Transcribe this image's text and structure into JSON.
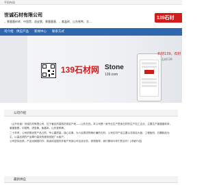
{
  "topbar": {
    "text": "平机布局"
  },
  "header": {
    "company_name": "世诚石材有限公司",
    "keywords": "，景墨墨砂砖、中国黑、虎皮黄、景墨墨基、，紫晶砖、山东铁鸭、文…",
    "logo_text": "139石材"
  },
  "nav": {
    "items": [
      {
        "label": "司介绍"
      },
      {
        "label": "供应产品"
      },
      {
        "label": "新闻中心"
      },
      {
        "label": "联系方式"
      }
    ]
  },
  "banner": {
    "brand_139": "139石材网",
    "brand_stone": "Stone",
    "brand_stone_sub": "139.com",
    "right_text": "石材139，石材",
    "right_sub": "石材139"
  },
  "about": {
    "title": "公司介绍",
    "paragraphs": [
      "（山东世诚）世诚石材有限公司，位于著名的高档花岗岩产地——山东石岛。本公司是一家专业生产售卖石材的生产加工企业，主要生产景墨墨砂砖，景墨墨基，中国黑，虎皮黄，紫晶砖，山东铁鸭等。",
      "二十年来，公司依照优质产品占的，专心重质量，诚心实事，为人民提供物美价廉的石材。公司石材产品主要以花岗岩大板、工程板材、石雕制品为主，以高品质的产品奉行高效的服务回报广大客户。",
      "公司坚持品质，产品远销国内外，真诚欢迎国内外客户来我公司洽谈业务，参观指导。我们期待与你们的合作！[详细介绍]"
    ],
    "more_label": "[详细介绍]"
  },
  "news": {
    "title": "最新供应"
  },
  "colors": {
    "nav": "#2f66b0",
    "brand_red": "#d11c1c"
  }
}
